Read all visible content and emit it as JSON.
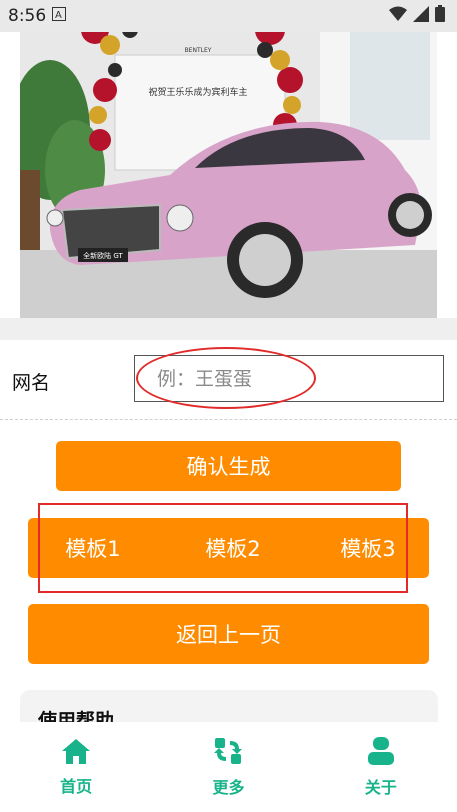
{
  "status_bar": {
    "time": "8:56",
    "icons": [
      "notification-a-icon",
      "wifi-icon",
      "signal-icon",
      "battery-icon"
    ]
  },
  "hero_image": {
    "sign_brand": "BENTLEY",
    "sign_text": "祝贺王乐乐成为宾利车主",
    "plate_text": "全新欧陆 GT"
  },
  "form": {
    "label": "网名",
    "input_value": "",
    "input_placeholder": "例：王蛋蛋"
  },
  "buttons": {
    "confirm": "确认生成",
    "templates": [
      "模板1",
      "模板2",
      "模板3"
    ],
    "back": "返回上一页"
  },
  "help": {
    "title": "使用帮助"
  },
  "tabs": [
    {
      "label": "首页",
      "icon": "home-icon"
    },
    {
      "label": "更多",
      "icon": "refresh-grid-icon"
    },
    {
      "label": "关于",
      "icon": "user-icon"
    }
  ],
  "colors": {
    "accent_orange": "#ff8c00",
    "tab_green": "#18b38a",
    "annotation_red": "#e12a2a",
    "car_pink": "#d8a3c8"
  }
}
